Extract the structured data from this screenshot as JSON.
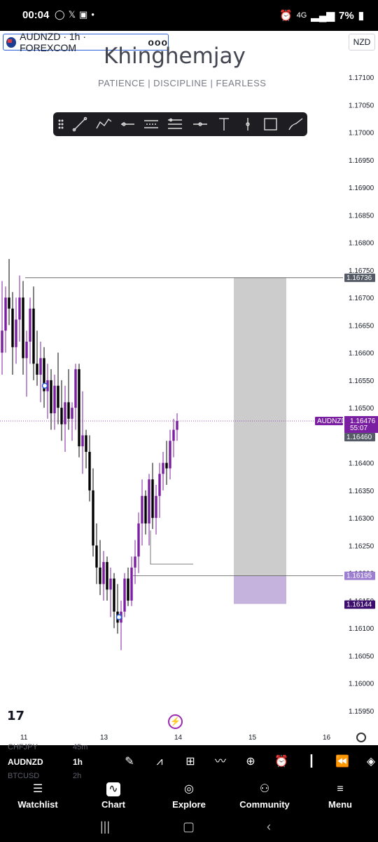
{
  "status_bar": {
    "time": "00:04",
    "battery": "7%",
    "network": "4G"
  },
  "chart_header": {
    "symbol_label": "AUDNZD · 1h · FOREXCOM",
    "more": "ooo",
    "currency": "NZD"
  },
  "watermark": {
    "title": "Khinghemjay",
    "subtitle": "PATIENCE  |  DISCIPLINE  |  FEARLESS"
  },
  "drawing_toolbar": {
    "tools": [
      "trend-line",
      "path",
      "horizontal-ray",
      "parallel-channel",
      "regression",
      "horizontal-line",
      "text",
      "vertical-line",
      "rectangle",
      "brush"
    ]
  },
  "price_axis": {
    "ticks": [
      "1.17100",
      "1.17050",
      "1.17000",
      "1.16950",
      "1.16900",
      "1.16850",
      "1.16800",
      "1.16750",
      "1.16700",
      "1.16650",
      "1.16600",
      "1.16550",
      "1.16500",
      "1.16450",
      "1.16400",
      "1.16350",
      "1.16300",
      "1.16250",
      "1.16200",
      "1.16150",
      "1.16100",
      "1.16050",
      "1.16000",
      "1.15950"
    ],
    "labels": {
      "top_level": "1.16736",
      "symbol_tag": "AUDNZD",
      "last_price": "1.16476",
      "countdown": "55:07",
      "level_mid": "1.16460",
      "entry": "1.16195",
      "stop": "1.16144"
    }
  },
  "time_axis": {
    "ticks": [
      "11",
      "13",
      "14",
      "15",
      "16"
    ]
  },
  "chart_data": {
    "type": "candlestick",
    "symbol": "AUDNZD",
    "timeframe": "1h",
    "ylim": [
      1.1592,
      1.1714
    ],
    "candles": [
      {
        "o": 1.166,
        "h": 1.1673,
        "l": 1.1656,
        "c": 1.1664
      },
      {
        "o": 1.1664,
        "h": 1.1672,
        "l": 1.166,
        "c": 1.167
      },
      {
        "o": 1.167,
        "h": 1.1677,
        "l": 1.1665,
        "c": 1.1668
      },
      {
        "o": 1.1668,
        "h": 1.1671,
        "l": 1.1656,
        "c": 1.1661
      },
      {
        "o": 1.1661,
        "h": 1.167,
        "l": 1.1658,
        "c": 1.1666
      },
      {
        "o": 1.1666,
        "h": 1.1674,
        "l": 1.1662,
        "c": 1.167
      },
      {
        "o": 1.167,
        "h": 1.1673,
        "l": 1.1656,
        "c": 1.1659
      },
      {
        "o": 1.1659,
        "h": 1.1664,
        "l": 1.1652,
        "c": 1.1662
      },
      {
        "o": 1.1662,
        "h": 1.167,
        "l": 1.1658,
        "c": 1.1668
      },
      {
        "o": 1.1668,
        "h": 1.1672,
        "l": 1.1655,
        "c": 1.1658
      },
      {
        "o": 1.1658,
        "h": 1.1664,
        "l": 1.1654,
        "c": 1.1656
      },
      {
        "o": 1.1656,
        "h": 1.1662,
        "l": 1.1651,
        "c": 1.1659
      },
      {
        "o": 1.1659,
        "h": 1.1661,
        "l": 1.165,
        "c": 1.1653
      },
      {
        "o": 1.1653,
        "h": 1.1658,
        "l": 1.1648,
        "c": 1.1655
      },
      {
        "o": 1.1655,
        "h": 1.1657,
        "l": 1.1646,
        "c": 1.1649
      },
      {
        "o": 1.1649,
        "h": 1.1656,
        "l": 1.1646,
        "c": 1.1654
      },
      {
        "o": 1.1654,
        "h": 1.166,
        "l": 1.1647,
        "c": 1.165
      },
      {
        "o": 1.165,
        "h": 1.1655,
        "l": 1.1644,
        "c": 1.1647
      },
      {
        "o": 1.1647,
        "h": 1.1654,
        "l": 1.1642,
        "c": 1.1651
      },
      {
        "o": 1.1651,
        "h": 1.1657,
        "l": 1.1646,
        "c": 1.1648
      },
      {
        "o": 1.1648,
        "h": 1.1651,
        "l": 1.1644,
        "c": 1.165
      },
      {
        "o": 1.165,
        "h": 1.1658,
        "l": 1.1646,
        "c": 1.1657
      },
      {
        "o": 1.1657,
        "h": 1.1658,
        "l": 1.1641,
        "c": 1.1643
      },
      {
        "o": 1.1643,
        "h": 1.1653,
        "l": 1.1638,
        "c": 1.1645
      },
      {
        "o": 1.1645,
        "h": 1.1646,
        "l": 1.1639,
        "c": 1.1642
      },
      {
        "o": 1.1642,
        "h": 1.1645,
        "l": 1.1633,
        "c": 1.1635
      },
      {
        "o": 1.1635,
        "h": 1.1639,
        "l": 1.1623,
        "c": 1.1625
      },
      {
        "o": 1.1625,
        "h": 1.1629,
        "l": 1.1618,
        "c": 1.1621
      },
      {
        "o": 1.1621,
        "h": 1.1626,
        "l": 1.1616,
        "c": 1.1618
      },
      {
        "o": 1.1618,
        "h": 1.1624,
        "l": 1.1615,
        "c": 1.1622
      },
      {
        "o": 1.1622,
        "h": 1.1623,
        "l": 1.1615,
        "c": 1.1617
      },
      {
        "o": 1.1617,
        "h": 1.1621,
        "l": 1.1612,
        "c": 1.1619
      },
      {
        "o": 1.1619,
        "h": 1.162,
        "l": 1.161,
        "c": 1.1613
      },
      {
        "o": 1.1613,
        "h": 1.1618,
        "l": 1.1609,
        "c": 1.1611
      },
      {
        "o": 1.1611,
        "h": 1.1615,
        "l": 1.1606,
        "c": 1.1613
      },
      {
        "o": 1.1613,
        "h": 1.162,
        "l": 1.1612,
        "c": 1.1619
      },
      {
        "o": 1.1619,
        "h": 1.1621,
        "l": 1.1614,
        "c": 1.1615
      },
      {
        "o": 1.1615,
        "h": 1.1623,
        "l": 1.1614,
        "c": 1.1621
      },
      {
        "o": 1.1621,
        "h": 1.1626,
        "l": 1.1618,
        "c": 1.1623
      },
      {
        "o": 1.1623,
        "h": 1.1631,
        "l": 1.162,
        "c": 1.1629
      },
      {
        "o": 1.1629,
        "h": 1.1637,
        "l": 1.1625,
        "c": 1.1634
      },
      {
        "o": 1.1634,
        "h": 1.1635,
        "l": 1.1627,
        "c": 1.1629
      },
      {
        "o": 1.1629,
        "h": 1.1638,
        "l": 1.1625,
        "c": 1.1637
      },
      {
        "o": 1.1637,
        "h": 1.164,
        "l": 1.1628,
        "c": 1.163
      },
      {
        "o": 1.163,
        "h": 1.1636,
        "l": 1.1627,
        "c": 1.1634
      },
      {
        "o": 1.1634,
        "h": 1.164,
        "l": 1.163,
        "c": 1.1638
      },
      {
        "o": 1.1638,
        "h": 1.1642,
        "l": 1.1635,
        "c": 1.164
      },
      {
        "o": 1.164,
        "h": 1.1644,
        "l": 1.1636,
        "c": 1.1639
      },
      {
        "o": 1.1639,
        "h": 1.1646,
        "l": 1.1637,
        "c": 1.1644
      },
      {
        "o": 1.1644,
        "h": 1.1648,
        "l": 1.1641,
        "c": 1.1646
      },
      {
        "o": 1.1646,
        "h": 1.1649,
        "l": 1.1644,
        "c": 1.16476
      }
    ],
    "horizontal_levels": [
      1.16736,
      1.16195
    ],
    "position_tool": {
      "entry": 1.16195,
      "target": 1.16736,
      "stop": 1.16144
    },
    "last_price": 1.16476,
    "colors": {
      "bull": "#7b1fa2",
      "bear": "#000000",
      "target_zone": "#cccccc",
      "stop_zone": "#c5b3dd",
      "accent": "#7b1fa2"
    }
  },
  "watchlist_strip": {
    "ghost_top": [
      "CHFJPY",
      "45m"
    ],
    "symbol": "AUDNZD",
    "timeframe": "1h",
    "ghost_bottom": [
      "BTCUSD",
      "2h"
    ],
    "icons": [
      "brush-icon",
      "indicators-icon",
      "layout-icon",
      "compare-icon",
      "add-icon",
      "alert-icon",
      "chart-type-icon",
      "replay-icon",
      "layers-icon"
    ]
  },
  "bottom_nav": {
    "items": [
      {
        "label": "Watchlist",
        "icon": "list-icon"
      },
      {
        "label": "Chart",
        "icon": "chart-icon"
      },
      {
        "label": "Explore",
        "icon": "compass-icon"
      },
      {
        "label": "Community",
        "icon": "people-icon"
      },
      {
        "label": "Menu",
        "icon": "hamburger-icon"
      }
    ]
  }
}
